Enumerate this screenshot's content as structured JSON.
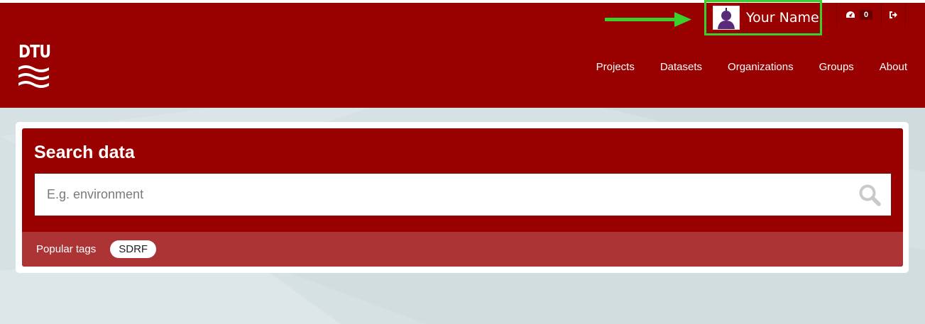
{
  "header": {
    "logo_text": "DTU",
    "account": {
      "name": "Your Name"
    },
    "tools": {
      "dashboard_count": "0"
    },
    "nav": [
      {
        "label": "Projects"
      },
      {
        "label": "Datasets"
      },
      {
        "label": "Organizations"
      },
      {
        "label": "Groups"
      },
      {
        "label": "About"
      }
    ]
  },
  "search": {
    "title": "Search data",
    "placeholder": "E.g. environment",
    "popular_tags_label": "Popular tags",
    "tags": [
      "SDRF"
    ]
  },
  "colors": {
    "brand_red": "#990000",
    "tags_bar": "#ad3434",
    "highlight_green": "#3ad12b",
    "background": "#d6e1e3"
  },
  "icons": [
    "dtu-logo-icon",
    "avatar-icon",
    "dashboard-icon",
    "logout-icon",
    "search-icon",
    "arrow-right-icon"
  ]
}
